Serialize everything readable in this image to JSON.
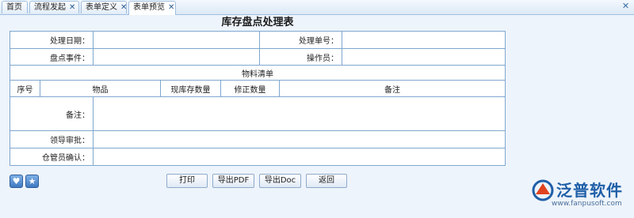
{
  "tabs": [
    {
      "label": "首页",
      "closable": false
    },
    {
      "label": "流程发起",
      "closable": true
    },
    {
      "label": "表单定义",
      "closable": true
    },
    {
      "label": "表单预览",
      "closable": true,
      "active": true
    }
  ],
  "window_close": "✕",
  "form": {
    "title": "库存盘点处理表",
    "fields": {
      "date_label": "处理日期：",
      "number_label": "处理单号：",
      "event_label": "盘点事件：",
      "operator_label": "操作员：",
      "remark_label": "备注：",
      "approval_label": "领导审批：",
      "keeper_label": "仓管员确认："
    },
    "materials_header": "物料清单",
    "columns": [
      "序号",
      "物品",
      "现库存数量",
      "修正数量",
      "备注"
    ]
  },
  "buttons": {
    "print": "打印",
    "export_pdf": "导出PDF",
    "export_doc": "导出Doc",
    "back": "返回"
  },
  "logo": {
    "text": "泛普软件",
    "url": "www.fanpusoft.com",
    "brand_color": "#1f5fa8"
  },
  "icons": {
    "heart": "heart-icon",
    "star": "star-icon"
  }
}
